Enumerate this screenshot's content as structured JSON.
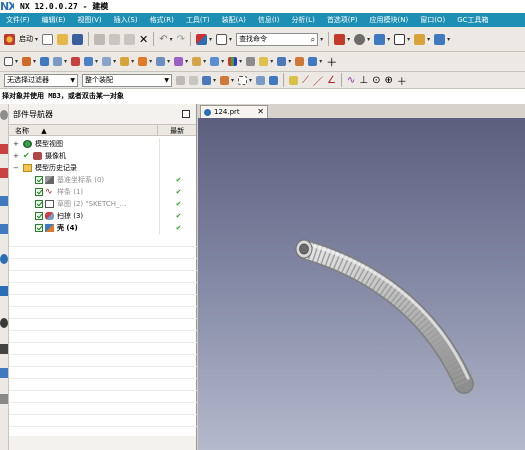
{
  "app": {
    "logo": "NX",
    "title": "NX 12.0.0.27 - 建模"
  },
  "menu": {
    "items": [
      "文件(F)",
      "编辑(E)",
      "视图(V)",
      "插入(S)",
      "格式(R)",
      "工具(T)",
      "装配(A)",
      "信息(I)",
      "分析(L)",
      "首选项(P)",
      "应用模块(N)",
      "窗口(O)",
      "GC工具箱"
    ]
  },
  "toolbar": {
    "start_label": "启动",
    "command_search_placeholder": "查找命令",
    "selection_filter_value": "无选择过滤器",
    "assembly_scope_value": "整个装配"
  },
  "prompt": {
    "text": "择对象并使用 MB3，或者双击某一对象"
  },
  "navigator": {
    "title": "部件导航器",
    "col_name": "名称",
    "col_latest": "最新",
    "nodes": [
      {
        "expander": "+",
        "label": "模型视图",
        "icon": "model-views-icon",
        "latest": ""
      },
      {
        "expander": "+",
        "label": "摄像机",
        "icon": "camera-icon",
        "latest": ""
      },
      {
        "expander": "−",
        "label": "模型历史记录",
        "icon": "folder-icon",
        "latest": ""
      },
      {
        "expander": "",
        "label": "基准坐标系 (0)",
        "icon": "datum-csys-icon",
        "latest": "✔"
      },
      {
        "expander": "",
        "label": "样条 (1)",
        "icon": "spline-icon",
        "latest": "✔"
      },
      {
        "expander": "",
        "label": "草图 (2) \"SKETCH_…",
        "icon": "sketch-icon",
        "latest": "✔"
      },
      {
        "expander": "",
        "label": "扫掠 (3)",
        "icon": "sweep-icon",
        "latest": "✔"
      },
      {
        "expander": "",
        "label": "壳 (4)",
        "icon": "shell-icon",
        "latest": "✔"
      }
    ]
  },
  "graphics": {
    "tab_label": "124.prt",
    "tab_close": "✕"
  },
  "colors": {
    "menu_bar": "#1e8fb4",
    "viewport_top": "#5c5f7e",
    "viewport_bottom": "#b5b9cc",
    "part_body": "#c4c4c4",
    "check_green": "#2aa02a"
  }
}
